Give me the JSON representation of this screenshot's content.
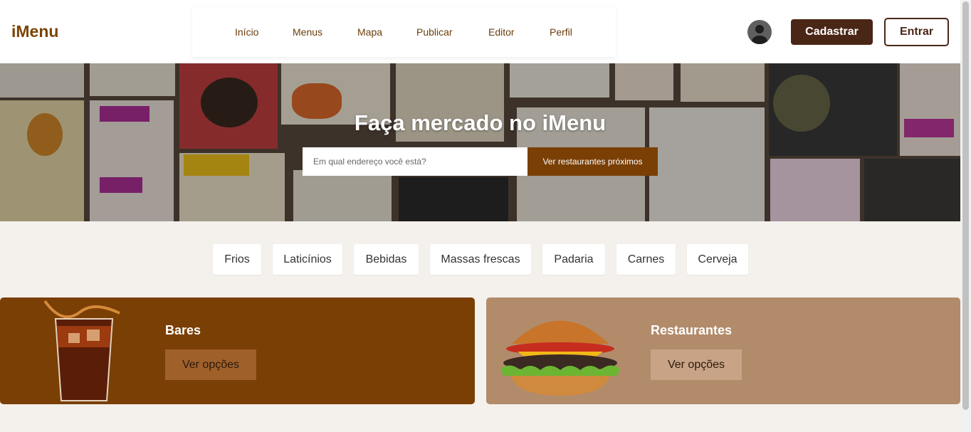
{
  "header": {
    "logo": "iMenu",
    "nav": [
      "Início",
      "Menus",
      "Mapa",
      "Publicar",
      "Editor",
      "Perfil"
    ],
    "register_label": "Cadastrar",
    "login_label": "Entrar"
  },
  "hero": {
    "title": "Faça mercado no iMenu",
    "search_placeholder": "Em qual endereço você está?",
    "search_button": "Ver restaurantes próximos"
  },
  "categories": [
    "Frios",
    "Laticínios",
    "Bebidas",
    "Massas frescas",
    "Padaria",
    "Carnes",
    "Cerveja"
  ],
  "cards": [
    {
      "title": "Bares",
      "button": "Ver opções",
      "color": "#7a3f05"
    },
    {
      "title": "Restaurantes",
      "button": "Ver opções",
      "color": "#b28b6b"
    }
  ],
  "colors": {
    "brand": "#7a4506",
    "dark": "#4a2616"
  }
}
